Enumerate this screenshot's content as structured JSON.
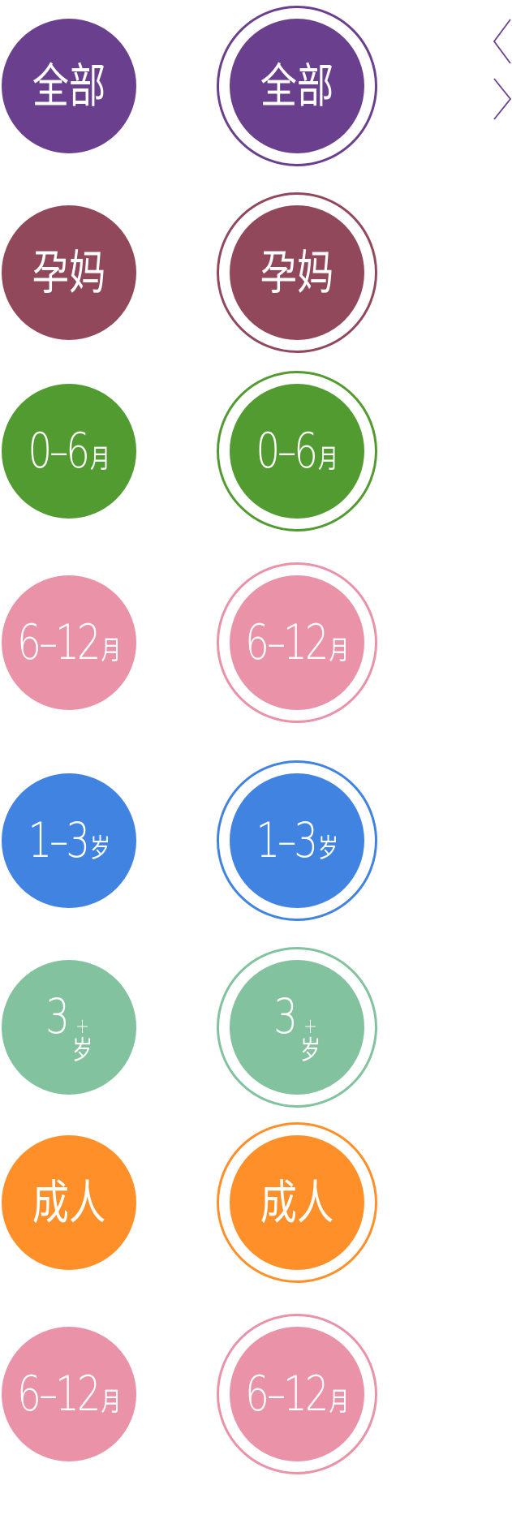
{
  "arrows": {
    "prev": "chevron-left",
    "next": "chevron-right",
    "color": "#6A3F8E"
  },
  "categories": [
    {
      "id": "all",
      "main": "全部",
      "unit": "",
      "color": "#6A3F8E",
      "plus": "",
      "cjk": true
    },
    {
      "id": "pregnancy",
      "main": "孕妈",
      "unit": "",
      "color": "#92485B",
      "plus": "",
      "cjk": true
    },
    {
      "id": "0-6m",
      "main": "0–6",
      "unit": "月",
      "color": "#519B31",
      "plus": "",
      "cjk": false
    },
    {
      "id": "6-12m",
      "main": "6–12",
      "unit": "月",
      "color": "#E992A8",
      "plus": "",
      "cjk": false
    },
    {
      "id": "1-3y",
      "main": "1–3",
      "unit": "岁",
      "color": "#4183E1",
      "plus": "",
      "cjk": false
    },
    {
      "id": "3y-plus",
      "main": "3",
      "unit": "岁",
      "color": "#82C29E",
      "plus": "+",
      "cjk": false
    },
    {
      "id": "adult",
      "main": "成人",
      "unit": "",
      "color": "#FF9029",
      "plus": "",
      "cjk": true
    },
    {
      "id": "6-12m-b",
      "main": "6–12",
      "unit": "月",
      "color": "#E992A8",
      "plus": "",
      "cjk": false
    }
  ]
}
